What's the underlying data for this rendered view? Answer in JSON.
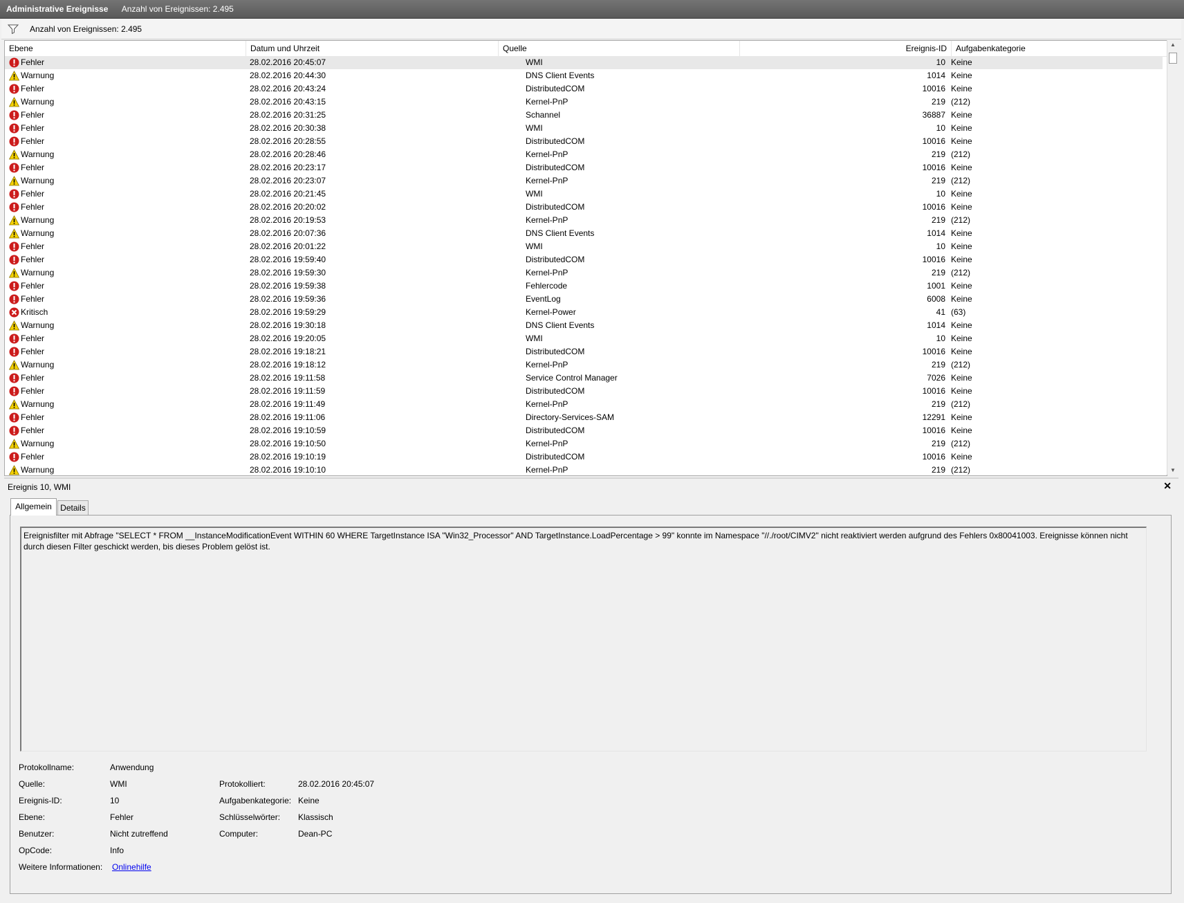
{
  "window": {
    "title": "Administrative Ereignisse",
    "count_label": "Anzahl von Ereignissen: 2.495"
  },
  "filterbar": {
    "icon": "filter-icon",
    "text": "Anzahl von Ereignissen: 2.495"
  },
  "grid": {
    "columns": {
      "level": "Ebene",
      "date": "Datum und Uhrzeit",
      "source": "Quelle",
      "id": "Ereignis-ID",
      "category": "Aufgabenkategorie"
    },
    "icons": {
      "Fehler": "error-icon",
      "Warnung": "warning-icon",
      "Kritisch": "critical-icon"
    },
    "colors": {
      "error": "#cc1c1c",
      "warning": "#f5d200",
      "selected_row": "#e8e8e8"
    },
    "rows": [
      {
        "level": "Fehler",
        "date": "28.02.2016 20:45:07",
        "source": "WMI",
        "id": "10",
        "category": "Keine"
      },
      {
        "level": "Warnung",
        "date": "28.02.2016 20:44:30",
        "source": "DNS Client Events",
        "id": "1014",
        "category": "Keine"
      },
      {
        "level": "Fehler",
        "date": "28.02.2016 20:43:24",
        "source": "DistributedCOM",
        "id": "10016",
        "category": "Keine"
      },
      {
        "level": "Warnung",
        "date": "28.02.2016 20:43:15",
        "source": "Kernel-PnP",
        "id": "219",
        "category": "(212)"
      },
      {
        "level": "Fehler",
        "date": "28.02.2016 20:31:25",
        "source": "Schannel",
        "id": "36887",
        "category": "Keine"
      },
      {
        "level": "Fehler",
        "date": "28.02.2016 20:30:38",
        "source": "WMI",
        "id": "10",
        "category": "Keine"
      },
      {
        "level": "Fehler",
        "date": "28.02.2016 20:28:55",
        "source": "DistributedCOM",
        "id": "10016",
        "category": "Keine"
      },
      {
        "level": "Warnung",
        "date": "28.02.2016 20:28:46",
        "source": "Kernel-PnP",
        "id": "219",
        "category": "(212)"
      },
      {
        "level": "Fehler",
        "date": "28.02.2016 20:23:17",
        "source": "DistributedCOM",
        "id": "10016",
        "category": "Keine"
      },
      {
        "level": "Warnung",
        "date": "28.02.2016 20:23:07",
        "source": "Kernel-PnP",
        "id": "219",
        "category": "(212)"
      },
      {
        "level": "Fehler",
        "date": "28.02.2016 20:21:45",
        "source": "WMI",
        "id": "10",
        "category": "Keine"
      },
      {
        "level": "Fehler",
        "date": "28.02.2016 20:20:02",
        "source": "DistributedCOM",
        "id": "10016",
        "category": "Keine"
      },
      {
        "level": "Warnung",
        "date": "28.02.2016 20:19:53",
        "source": "Kernel-PnP",
        "id": "219",
        "category": "(212)"
      },
      {
        "level": "Warnung",
        "date": "28.02.2016 20:07:36",
        "source": "DNS Client Events",
        "id": "1014",
        "category": "Keine"
      },
      {
        "level": "Fehler",
        "date": "28.02.2016 20:01:22",
        "source": "WMI",
        "id": "10",
        "category": "Keine"
      },
      {
        "level": "Fehler",
        "date": "28.02.2016 19:59:40",
        "source": "DistributedCOM",
        "id": "10016",
        "category": "Keine"
      },
      {
        "level": "Warnung",
        "date": "28.02.2016 19:59:30",
        "source": "Kernel-PnP",
        "id": "219",
        "category": "(212)"
      },
      {
        "level": "Fehler",
        "date": "28.02.2016 19:59:38",
        "source": "Fehlercode",
        "id": "1001",
        "category": "Keine"
      },
      {
        "level": "Fehler",
        "date": "28.02.2016 19:59:36",
        "source": "EventLog",
        "id": "6008",
        "category": "Keine"
      },
      {
        "level": "Kritisch",
        "date": "28.02.2016 19:59:29",
        "source": "Kernel-Power",
        "id": "41",
        "category": "(63)"
      },
      {
        "level": "Warnung",
        "date": "28.02.2016 19:30:18",
        "source": "DNS Client Events",
        "id": "1014",
        "category": "Keine"
      },
      {
        "level": "Fehler",
        "date": "28.02.2016 19:20:05",
        "source": "WMI",
        "id": "10",
        "category": "Keine"
      },
      {
        "level": "Fehler",
        "date": "28.02.2016 19:18:21",
        "source": "DistributedCOM",
        "id": "10016",
        "category": "Keine"
      },
      {
        "level": "Warnung",
        "date": "28.02.2016 19:18:12",
        "source": "Kernel-PnP",
        "id": "219",
        "category": "(212)"
      },
      {
        "level": "Fehler",
        "date": "28.02.2016 19:11:58",
        "source": "Service Control Manager",
        "id": "7026",
        "category": "Keine"
      },
      {
        "level": "Fehler",
        "date": "28.02.2016 19:11:59",
        "source": "DistributedCOM",
        "id": "10016",
        "category": "Keine"
      },
      {
        "level": "Warnung",
        "date": "28.02.2016 19:11:49",
        "source": "Kernel-PnP",
        "id": "219",
        "category": "(212)"
      },
      {
        "level": "Fehler",
        "date": "28.02.2016 19:11:06",
        "source": "Directory-Services-SAM",
        "id": "12291",
        "category": "Keine"
      },
      {
        "level": "Fehler",
        "date": "28.02.2016 19:10:59",
        "source": "DistributedCOM",
        "id": "10016",
        "category": "Keine"
      },
      {
        "level": "Warnung",
        "date": "28.02.2016 19:10:50",
        "source": "Kernel-PnP",
        "id": "219",
        "category": "(212)"
      },
      {
        "level": "Fehler",
        "date": "28.02.2016 19:10:19",
        "source": "DistributedCOM",
        "id": "10016",
        "category": "Keine"
      },
      {
        "level": "Warnung",
        "date": "28.02.2016 19:10:10",
        "source": "Kernel-PnP",
        "id": "219",
        "category": "(212)"
      }
    ]
  },
  "detail": {
    "title": "Ereignis 10, WMI",
    "close_icon": "close-icon",
    "tabs": {
      "general": "Allgemein",
      "details": "Details"
    },
    "description": "Ereignisfilter mit Abfrage \"SELECT * FROM __InstanceModificationEvent WITHIN 60 WHERE TargetInstance ISA \"Win32_Processor\" AND TargetInstance.LoadPercentage > 99\" konnte im Namespace \"//./root/CIMV2\" nicht reaktiviert werden aufgrund des Fehlers 0x80041003. Ereignisse können nicht durch diesen Filter geschickt werden, bis dieses Problem gelöst ist.",
    "props": {
      "logname_label": "Protokollname:",
      "logname": "Anwendung",
      "source_label": "Quelle:",
      "source": "WMI",
      "logged_label": "Protokolliert:",
      "logged": "28.02.2016 20:45:07",
      "eventid_label": "Ereignis-ID:",
      "eventid": "10",
      "taskcat_label": "Aufgabenkategorie:",
      "taskcat": "Keine",
      "level_label": "Ebene:",
      "level": "Fehler",
      "keywords_label": "Schlüsselwörter:",
      "keywords": "Klassisch",
      "user_label": "Benutzer:",
      "user": "Nicht zutreffend",
      "computer_label": "Computer:",
      "computer": "Dean-PC",
      "opcode_label": "OpCode:",
      "opcode": "Info",
      "moreinfo_label": "Weitere Informationen:",
      "moreinfo_link": "Onlinehilfe"
    }
  }
}
